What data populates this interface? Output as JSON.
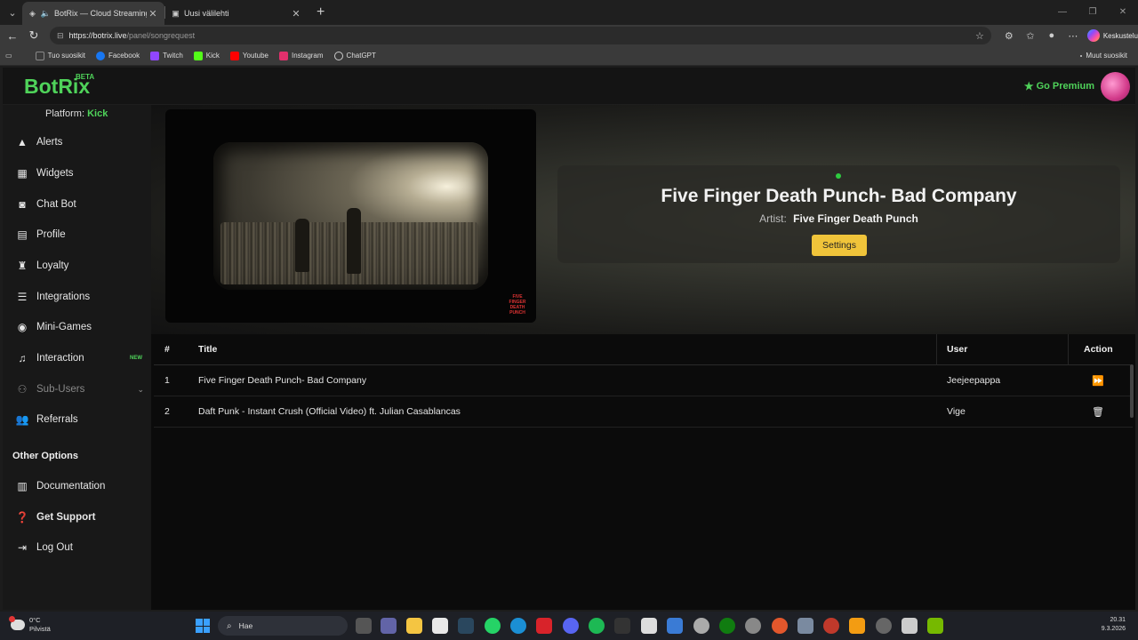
{
  "browser": {
    "tabs": [
      {
        "title": "BotRix — Cloud Streaming Bot",
        "active": true
      },
      {
        "title": "Uusi välilehti",
        "active": false
      }
    ],
    "url_host": "https://botrix.live",
    "url_path": "/panel/songrequest",
    "copilot_label": "Keskustelu",
    "bookmarks": [
      {
        "label": "Tuo suosikit",
        "color": "#888888"
      },
      {
        "label": "Facebook",
        "color": "#1877f2"
      },
      {
        "label": "Twitch",
        "color": "#9146ff"
      },
      {
        "label": "Kick",
        "color": "#53fc18"
      },
      {
        "label": "Youtube",
        "color": "#ff0000"
      },
      {
        "label": "Instagram",
        "color": "#e1306c"
      },
      {
        "label": "ChatGPT",
        "color": "#cccccc"
      }
    ],
    "other_favorites": "Muut suosikit"
  },
  "app": {
    "logo": "BotRix",
    "logo_badge": "BETA",
    "premium_label": "Go Premium",
    "accent_color": "#4fd35a"
  },
  "sidebar": {
    "platform_label": "Platform:",
    "platform_value": "Kick",
    "items": [
      {
        "label": "Alerts",
        "icon": "warning-icon"
      },
      {
        "label": "Widgets",
        "icon": "grid-icon"
      },
      {
        "label": "Chat Bot",
        "icon": "robot-icon"
      },
      {
        "label": "Profile",
        "icon": "id-card-icon"
      },
      {
        "label": "Loyalty",
        "icon": "trophy-icon"
      },
      {
        "label": "Integrations",
        "icon": "list-icon"
      },
      {
        "label": "Mini-Games",
        "icon": "gamepad-icon"
      },
      {
        "label": "Interaction",
        "icon": "music-icon",
        "badge": "NEW"
      },
      {
        "label": "Sub-Users",
        "icon": "users-icon"
      },
      {
        "label": "Referrals",
        "icon": "user-friends-icon"
      }
    ],
    "other_options_title": "Other Options",
    "other_items": [
      {
        "label": "Documentation",
        "icon": "book-icon"
      },
      {
        "label": "Get Support",
        "icon": "question-icon"
      },
      {
        "label": "Log Out",
        "icon": "logout-icon"
      }
    ]
  },
  "now_playing": {
    "title": "Five Finger Death Punch- Bad Company",
    "artist_label": "Artist:",
    "artist": "Five Finger Death Punch",
    "settings_label": "Settings",
    "video_watermark": "FIVE FINGER DEATH PUNCH"
  },
  "queue": {
    "headers": {
      "num": "#",
      "title": "Title",
      "user": "User",
      "action": "Action"
    },
    "rows": [
      {
        "num": "1",
        "title": "Five Finger Death Punch- Bad Company",
        "user": "Jeejeepappa",
        "action_icon": "skip-icon"
      },
      {
        "num": "2",
        "title": "Daft Punk - Instant Crush (Official Video) ft. Julian Casablancas",
        "user": "Vige",
        "action_icon": "trash-icon"
      }
    ]
  },
  "taskbar": {
    "temperature": "0°C",
    "weather": "Pilvistä",
    "search_placeholder": "Hae",
    "time": "20.31",
    "date": "9.3.2026"
  }
}
